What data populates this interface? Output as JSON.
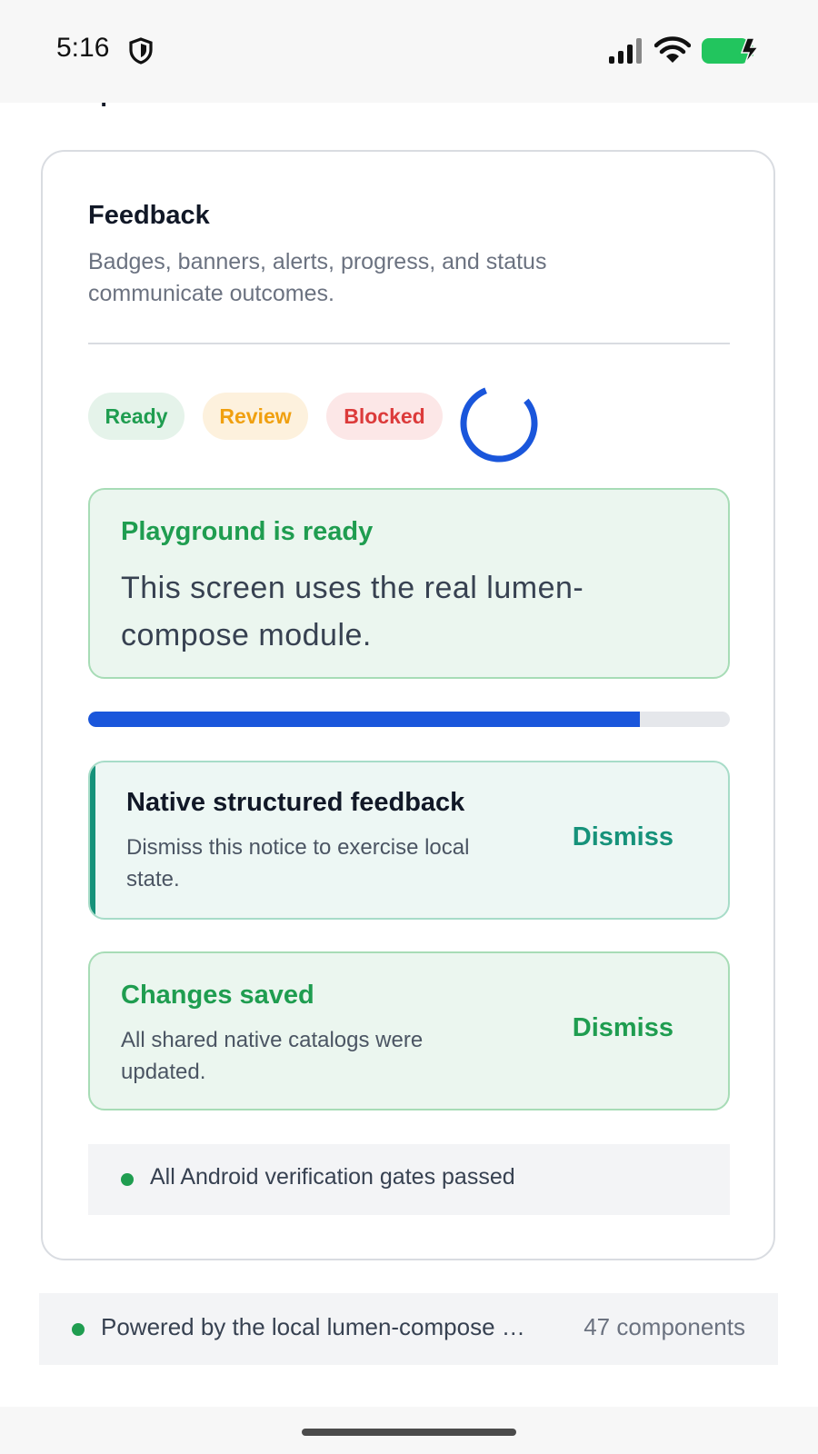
{
  "status_bar": {
    "time": "5:16",
    "icons": [
      "shield-icon",
      "signal-icon",
      "wifi-icon",
      "battery-charging-icon"
    ],
    "battery_color": "#22c55e"
  },
  "header": {
    "title_partial": "Components"
  },
  "card": {
    "title": "Feedback",
    "description": "Badges, banners, alerts, progress, and status communicate outcomes.",
    "badges": [
      {
        "label": "Ready",
        "color": "#1f9d50"
      },
      {
        "label": "Review",
        "color": "#f0a010"
      },
      {
        "label": "Blocked",
        "color": "#dc3b3b"
      }
    ],
    "spinner_color": "#1a56db",
    "success_banner": {
      "title": "Playground is ready",
      "body": "This screen uses the real lumen-compose module."
    },
    "progress": {
      "value": 0.86,
      "color": "#1a56db"
    },
    "notice": {
      "title": "Native structured feedback",
      "body": "Dismiss this notice to exercise local state.",
      "action": "Dismiss",
      "accent_color": "#16927a"
    },
    "saved_alert": {
      "title": "Changes saved",
      "body": "All shared native catalogs were updated.",
      "action": "Dismiss"
    },
    "status_row": {
      "text": "All Android verification gates passed"
    }
  },
  "footer": {
    "text": "Powered by the local lumen-compose module",
    "count": "47 components"
  }
}
